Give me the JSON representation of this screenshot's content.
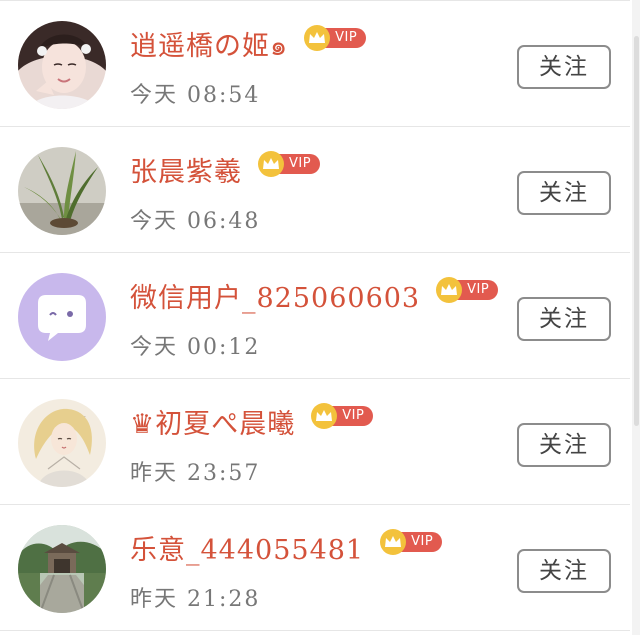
{
  "users": [
    {
      "name": "逍遥橋の姬๑",
      "time": "今天 08:54",
      "vip_label": "VIP",
      "follow_label": "关注",
      "avatar_icon": "avatar-girl-portrait-icon"
    },
    {
      "name": "张晨紫羲",
      "time": "今天 06:48",
      "vip_label": "VIP",
      "follow_label": "关注",
      "avatar_icon": "avatar-plant-photo-icon"
    },
    {
      "name": "微信用户_825060603",
      "time": "今天 00:12",
      "vip_label": "VIP",
      "follow_label": "关注",
      "avatar_icon": "avatar-default-chat-bubble-icon"
    },
    {
      "name": "♛初夏ぺ晨曦",
      "time": "昨天 23:57",
      "vip_label": "VIP",
      "follow_label": "关注",
      "avatar_icon": "avatar-illustrated-girl-icon"
    },
    {
      "name": "乐意_444055481",
      "time": "昨天 21:28",
      "vip_label": "VIP",
      "follow_label": "关注",
      "avatar_icon": "avatar-garden-photo-icon"
    }
  ],
  "colors": {
    "name": "#d4523a",
    "vip_pill": "#e25a4f",
    "vip_crown": "#f3c23c",
    "time": "#777777",
    "button_border": "#8c8c8c",
    "divider": "#e6e6e6"
  }
}
